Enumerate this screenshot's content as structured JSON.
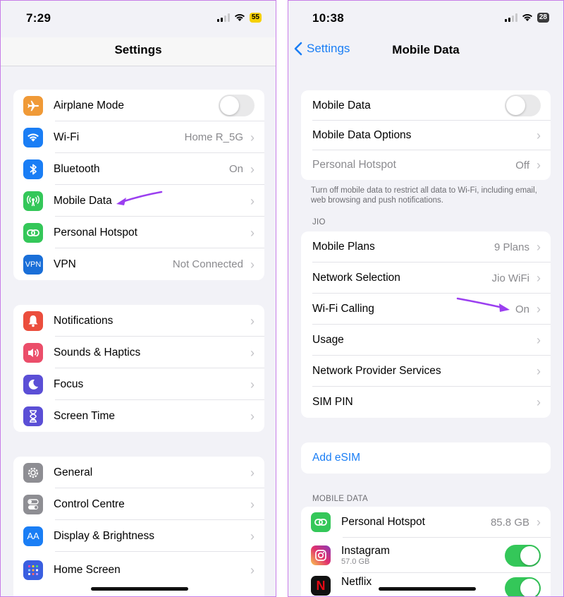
{
  "left": {
    "status": {
      "time": "7:29",
      "battery": "55"
    },
    "nav_title": "Settings",
    "group1": [
      {
        "label": "Airplane Mode",
        "value": "",
        "icon": "airplane-icon",
        "color": "#f09a37"
      },
      {
        "label": "Wi-Fi",
        "value": "Home R_5G",
        "icon": "wifi-icon",
        "color": "#1a7ef5"
      },
      {
        "label": "Bluetooth",
        "value": "On",
        "icon": "bluetooth-icon",
        "color": "#1a7ef5"
      },
      {
        "label": "Mobile Data",
        "value": "",
        "icon": "antenna-icon",
        "color": "#34c759"
      },
      {
        "label": "Personal Hotspot",
        "value": "",
        "icon": "hotspot-icon",
        "color": "#34c759"
      },
      {
        "label": "VPN",
        "value": "Not Connected",
        "icon": "vpn-icon",
        "icon_text": "VPN",
        "color": "#1a6fd8"
      }
    ],
    "group2": [
      {
        "label": "Notifications",
        "icon": "bell-icon",
        "color": "#eb4e3d"
      },
      {
        "label": "Sounds & Haptics",
        "icon": "speaker-icon",
        "color": "#eb4e6a"
      },
      {
        "label": "Focus",
        "icon": "moon-icon",
        "color": "#5b4fd6"
      },
      {
        "label": "Screen Time",
        "icon": "hourglass-icon",
        "color": "#5b4fd6"
      }
    ],
    "group3": [
      {
        "label": "General",
        "icon": "gear-icon",
        "color": "#8e8e93"
      },
      {
        "label": "Control Centre",
        "icon": "switches-icon",
        "color": "#8e8e93"
      },
      {
        "label": "Display & Brightness",
        "icon": "text-size-icon",
        "icon_text": "AA",
        "color": "#1a7ef5"
      },
      {
        "label": "Home Screen",
        "icon": "grid-icon",
        "color": "#3a5fe0"
      }
    ]
  },
  "right": {
    "status": {
      "time": "10:38",
      "battery": "28"
    },
    "back_label": "Settings",
    "nav_title": "Mobile Data",
    "group1": [
      {
        "label": "Mobile Data",
        "value": ""
      },
      {
        "label": "Mobile Data Options",
        "value": ""
      },
      {
        "label": "Personal Hotspot",
        "value": "Off"
      }
    ],
    "footer": "Turn off mobile data to restrict all data to Wi-Fi, including email, web browsing and push notifications.",
    "jio_header": "JIO",
    "group2": [
      {
        "label": "Mobile Plans",
        "value": "9 Plans"
      },
      {
        "label": "Network Selection",
        "value": "Jio WiFi"
      },
      {
        "label": "Wi-Fi Calling",
        "value": "On"
      },
      {
        "label": "Usage",
        "value": ""
      },
      {
        "label": "Network Provider Services",
        "value": ""
      },
      {
        "label": "SIM PIN",
        "value": ""
      }
    ],
    "add_esim": "Add eSIM",
    "mobile_data_header": "MOBILE DATA",
    "apps": [
      {
        "label": "Personal Hotspot",
        "value": "85.8 GB",
        "icon": "hotspot-icon",
        "color": "#34c759"
      },
      {
        "label": "Instagram",
        "sub": "57.0 GB",
        "icon": "instagram-icon",
        "color": "#d6306f"
      },
      {
        "label": "Netflix",
        "sub": "",
        "icon": "netflix-icon",
        "color": "#111111"
      }
    ]
  },
  "colors": {
    "accent": "#1a7ef5",
    "annotation_arrow": "#9b3ff0",
    "toggle_on": "#34c759"
  }
}
